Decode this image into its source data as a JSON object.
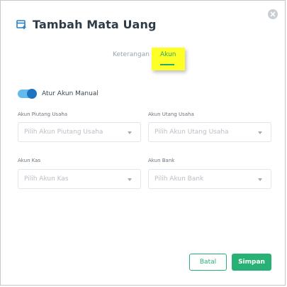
{
  "dialog": {
    "title": "Tambah Mata Uang",
    "close_icon": "close-icon",
    "header_icon": "currency-add-icon"
  },
  "tabs": [
    {
      "label": "Keterangan",
      "active": false
    },
    {
      "label": "Akun",
      "active": true
    }
  ],
  "toggle": {
    "label": "Atur Akun Manual",
    "on": true,
    "color_track": "#64b9ee",
    "color_knob": "#1f74c0"
  },
  "fields": {
    "piutang": {
      "label": "Akun Piutang Usaha",
      "placeholder": "Pilih Akun Piutang Usaha"
    },
    "utang": {
      "label": "Akun Utang Usaha",
      "placeholder": "Pilih Akun Utang Usaha"
    },
    "kas": {
      "label": "Akun Kas",
      "placeholder": "Pilih Akun Kas"
    },
    "bank": {
      "label": "Akun Bank",
      "placeholder": "Pilih Akun Bank"
    }
  },
  "buttons": {
    "cancel": "Batal",
    "save": "Simpan"
  },
  "colors": {
    "accent": "#27b174",
    "highlight": "#ffff28",
    "title": "#2f3b47"
  }
}
